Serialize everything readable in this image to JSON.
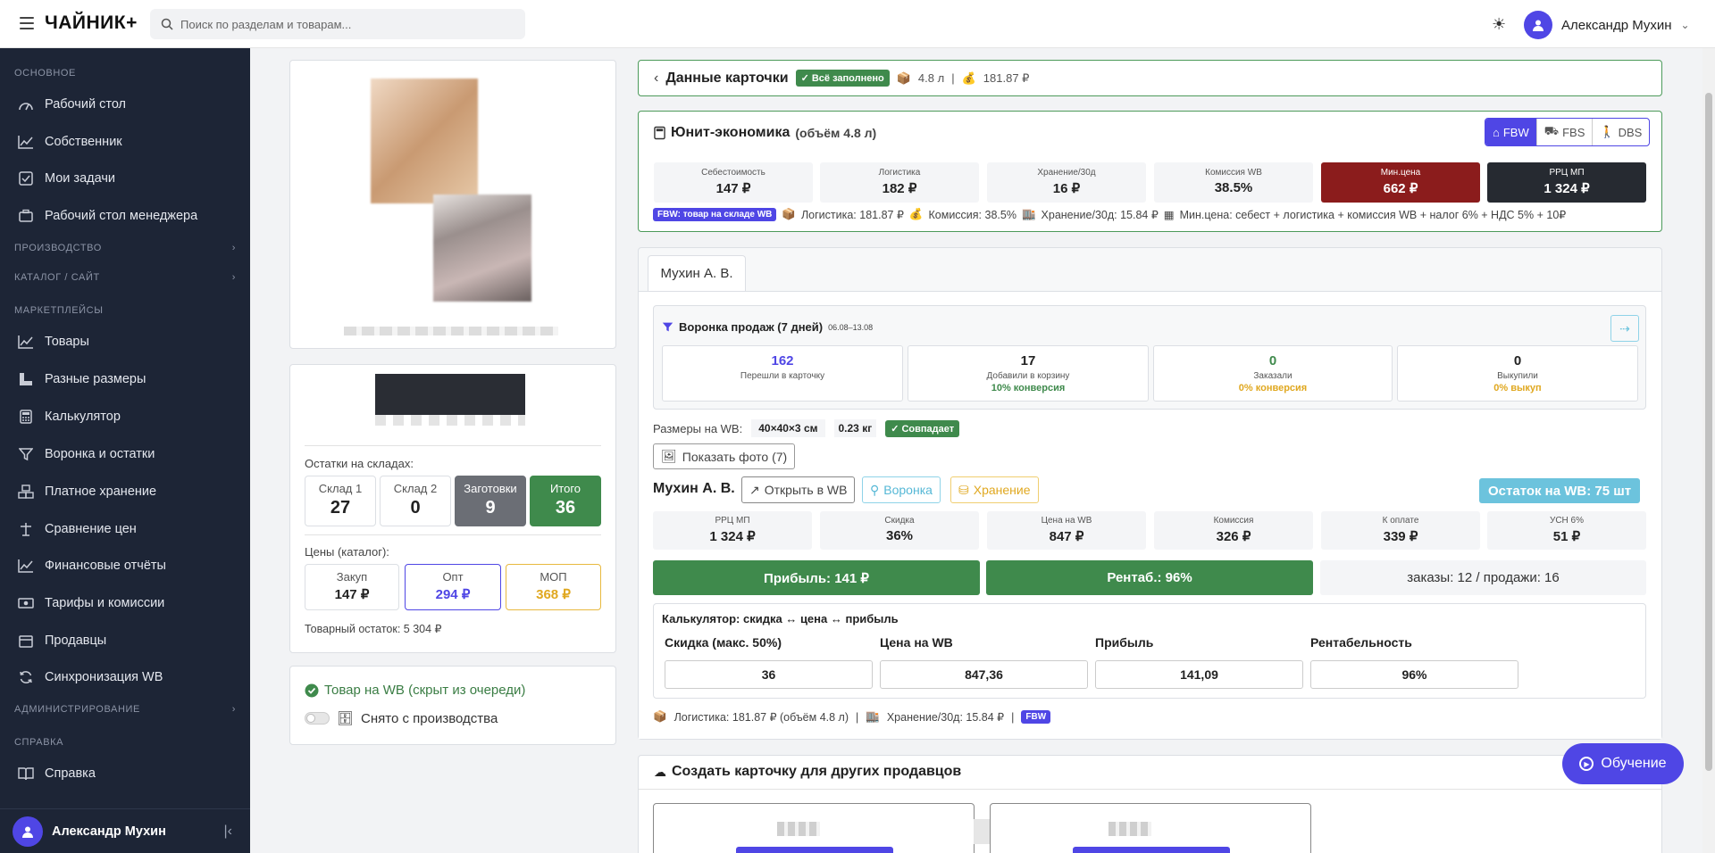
{
  "app": {
    "logo": "ЧАЙНИК+",
    "search_placeholder": "Поиск по разделам и товарам...",
    "user": "Александр Мухин"
  },
  "sidebar": {
    "sections": {
      "main": "ОСНОВНОЕ",
      "production": "ПРОИЗВОДСТВО",
      "catalog": "КАТАЛОГ / САЙТ",
      "marketplaces": "МАРКЕТПЛЕЙСЫ",
      "admin": "АДМИНИСТРИРОВАНИЕ",
      "help": "СПРАВКА"
    },
    "main": [
      "Рабочий стол",
      "Собственник",
      "Мои задачи",
      "Рабочий стол менеджера"
    ],
    "market": [
      "Товары",
      "Разные размеры",
      "Калькулятор",
      "Воронка и остатки",
      "Платное хранение",
      "Сравнение цен",
      "Финансовые отчёты",
      "Тарифы и комиссии",
      "Продавцы",
      "Синхронизация WB"
    ],
    "help": [
      "Справка"
    ],
    "footer_user": "Александр Мухин"
  },
  "left": {
    "stock_title": "Остатки на складах:",
    "stocks": [
      {
        "label": "Склад 1",
        "value": "27"
      },
      {
        "label": "Склад 2",
        "value": "0"
      },
      {
        "label": "Заготовки",
        "value": "9"
      },
      {
        "label": "Итого",
        "value": "36"
      }
    ],
    "prices_title": "Цены (каталог):",
    "prices": [
      {
        "label": "Закуп",
        "value": "147 ₽"
      },
      {
        "label": "Опт",
        "value": "294 ₽"
      },
      {
        "label": "МОП",
        "value": "368 ₽"
      }
    ],
    "goods_rest": "Товарный остаток: 5 304 ₽",
    "wb_status": "Товар на WB (скрыт из очереди)",
    "removed": "Снято с производства"
  },
  "card_header": {
    "title": "Данные карточки",
    "badge": "Всё заполнено",
    "volume": "4.8 л",
    "sep": "|",
    "price": "181.87 ₽"
  },
  "unit": {
    "title": "Юнит-экономика",
    "subtitle": "(объём 4.8 л)",
    "tabs": [
      "FBW",
      "FBS",
      "DBS"
    ],
    "metrics": [
      {
        "label": "Себестоимость",
        "value": "147 ₽"
      },
      {
        "label": "Логистика",
        "value": "182 ₽"
      },
      {
        "label": "Хранение/30д",
        "value": "16 ₽"
      },
      {
        "label": "Комиссия WB",
        "value": "38.5%"
      },
      {
        "label": "Мин.цена",
        "value": "662 ₽"
      },
      {
        "label": "РРЦ МП",
        "value": "1 324 ₽"
      }
    ],
    "badge": "FBW: товар на складе WB",
    "logistics": "Логистика: 181.87 ₽",
    "commission": "Комиссия: 38.5%",
    "storage": "Хранение/30д: 15.84 ₽",
    "formula": "Мин.цена: себест + логистика + комиссия WB + налог 6% + НДС 5% + 10₽"
  },
  "seller": {
    "tab": "Мухин А. В.",
    "funnel_title": "Воронка продаж (7 дней)",
    "funnel_dates": "06.08–13.08",
    "funnel": [
      {
        "value": "162",
        "label": "Перешли в карточку",
        "conv": ""
      },
      {
        "value": "17",
        "label": "Добавили в корзину",
        "conv": "10% конверсия"
      },
      {
        "value": "0",
        "label": "Заказали",
        "conv": "0% конверсия"
      },
      {
        "value": "0",
        "label": "Выкупили",
        "conv": "0% выкуп"
      }
    ],
    "sizes_label": "Размеры на WB:",
    "sizes": "40×40×3 см",
    "weight": "0.23 кг",
    "match": "Совпадает",
    "show_photo": "Показать фото (7)",
    "name": "Мухин А. В.",
    "open_wb": "Открыть в WB",
    "funnel_btn": "Воронка",
    "storage_btn": "Хранение",
    "rest_wb": "Остаток на WB: 75 шт",
    "metrics": [
      {
        "label": "РРЦ МП",
        "value": "1 324 ₽"
      },
      {
        "label": "Скидка",
        "value": "36%"
      },
      {
        "label": "Цена на WB",
        "value": "847 ₽"
      },
      {
        "label": "Комиссия",
        "value": "326 ₽"
      },
      {
        "label": "К оплате",
        "value": "339 ₽"
      },
      {
        "label": "УСН 6%",
        "value": "51 ₽"
      }
    ],
    "profit": "Прибыль: 141 ₽",
    "rent": "Рентаб.: 96%",
    "orders": "заказы: 12 / продажи: 16",
    "calc_title": "Калькулятор: скидка ↔ цена ↔ прибыль",
    "calc_labels": [
      "Скидка (макс. 50%)",
      "Цена на WB",
      "Прибыль",
      "Рентабельность"
    ],
    "calc_values": [
      "36",
      "847,36",
      "141,09",
      "96%"
    ],
    "footer_logistics": "Логистика: 181.87 ₽ (объём 4.8 л)",
    "footer_storage": "Хранение/30д: 15.84 ₽",
    "footer_badge": "FBW"
  },
  "create": {
    "title": "Создать карточку для других продавцов"
  },
  "tutorial": "Обучение"
}
